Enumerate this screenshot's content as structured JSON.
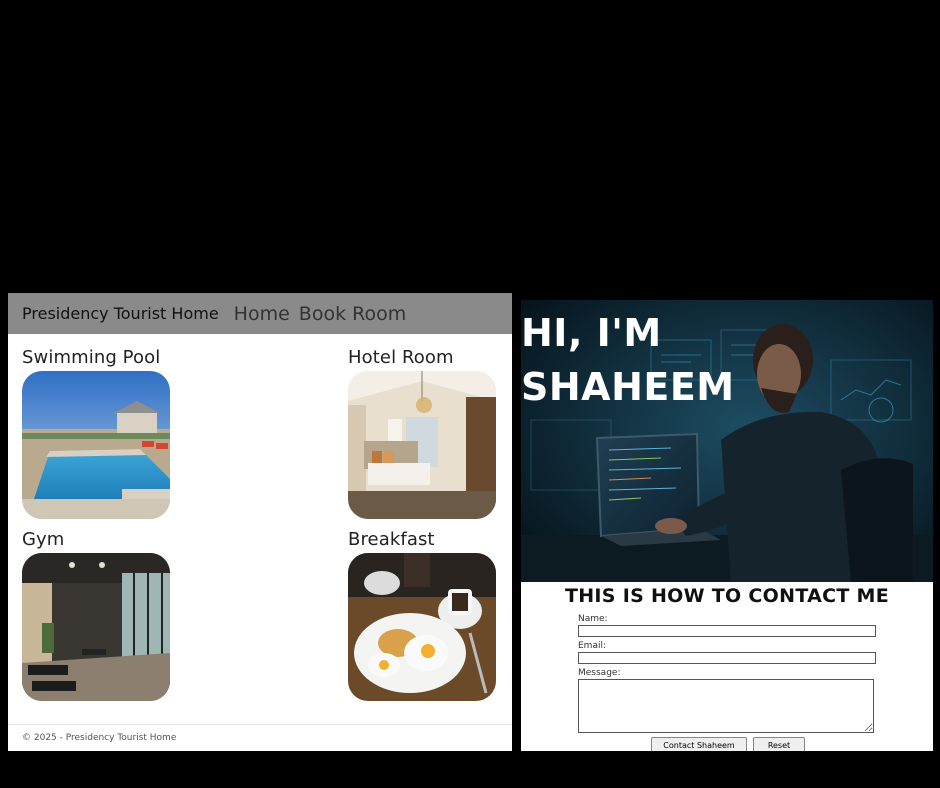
{
  "hotel_site": {
    "brand": "Presidency Tourist Home",
    "nav": [
      "Home",
      "Book Room"
    ],
    "cards": [
      {
        "title": "Swimming Pool"
      },
      {
        "title": "Hotel Room"
      },
      {
        "title": "Gym"
      },
      {
        "title": "Breakfast"
      }
    ],
    "footer": "© 2025 - Presidency Tourist Home",
    "colors": {
      "navbar": "#8a8a8a",
      "background": "#ffffff"
    }
  },
  "portfolio": {
    "hero_line1": "HI, I'M",
    "hero_line2": "SHAHEEM",
    "contact_title": "THIS IS HOW TO CONTACT ME",
    "form": {
      "name_label": "Name:",
      "email_label": "Email:",
      "message_label": "Message:",
      "submit_label": "Contact Shaheem",
      "reset_label": "Reset"
    },
    "colors": {
      "hero_bg": "#0a1f2b",
      "accent": "#3aa7d6"
    }
  }
}
